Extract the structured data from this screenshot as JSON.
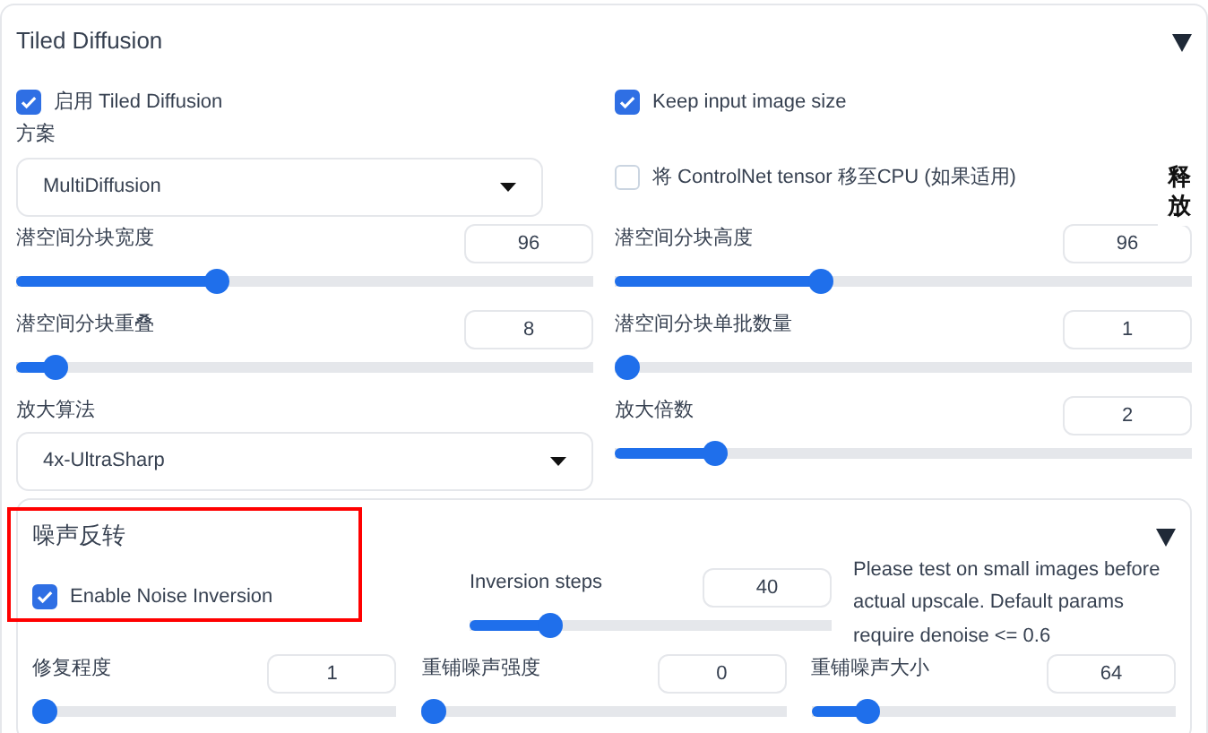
{
  "panel": {
    "title": "Tiled Diffusion",
    "expanded": true,
    "rows": [
      [
        {
          "kind": "checkbox",
          "label": "启用 Tiled Diffusion",
          "checked": true
        },
        {
          "kind": "checkbox",
          "label": "Keep input image size",
          "checked": true
        }
      ],
      [
        {
          "kind": "dropdown",
          "label": "方案",
          "value": "MultiDiffusion"
        },
        {
          "kind": "checkbox",
          "label": "将 ControlNet tensor 移至CPU (如果适用)",
          "checked": false
        }
      ],
      [
        {
          "kind": "slider",
          "label": "潜空间分块宽度",
          "value": "96",
          "level": 0.34
        },
        {
          "kind": "slider",
          "label": "潜空间分块高度",
          "value": "96",
          "level": 0.35
        }
      ],
      [
        {
          "kind": "slider",
          "label": "潜空间分块重叠",
          "value": "8",
          "level": 0.05
        },
        {
          "kind": "slider",
          "label": "潜空间分块单批数量",
          "value": "1",
          "level": 0
        }
      ],
      [
        {
          "kind": "dropdown",
          "label": "放大算法",
          "value": "4x-UltraSharp"
        },
        {
          "kind": "slider",
          "label": "放大倍数",
          "value": "2",
          "level": 0.16
        }
      ]
    ]
  },
  "side_button": {
    "label": "释放"
  },
  "noise_inversion": {
    "title": "噪声反转",
    "expanded": true,
    "highlighted": true,
    "enable": {
      "label": "Enable Noise Inversion",
      "checked": true
    },
    "steps": {
      "label": "Inversion steps",
      "value": "40",
      "level": 0.2
    },
    "note": "Please test on small images before actual upscale. Default params require denoise <= 0.6",
    "sliders": [
      {
        "label": "修复程度",
        "value": "1",
        "level": 0
      },
      {
        "label": "重铺噪声强度",
        "value": "0",
        "level": 0
      },
      {
        "label": "重铺噪声大小",
        "value": "64",
        "level": 0.13
      }
    ]
  }
}
